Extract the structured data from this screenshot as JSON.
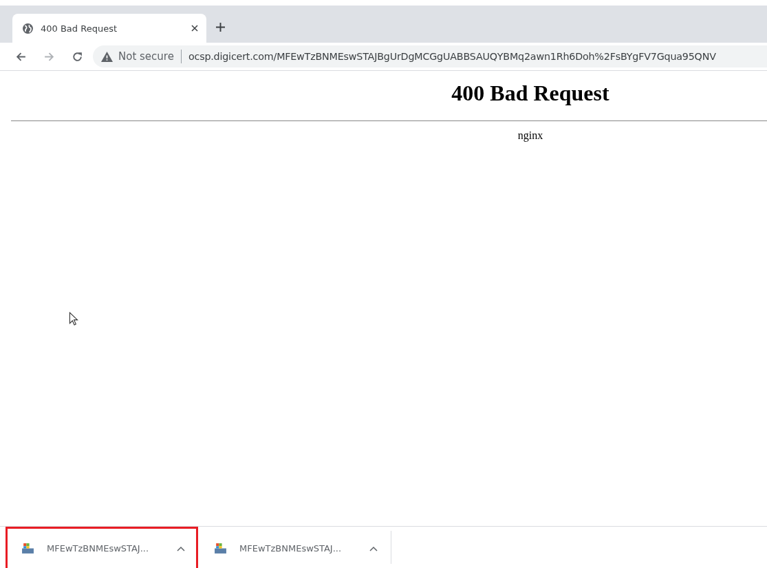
{
  "tabs": [
    {
      "title": "400 Bad Request",
      "selected": true
    }
  ],
  "address_bar": {
    "security": "Not secure",
    "url": "ocsp.digicert.com/MFEwTzBNMEswSTAJBgUrDgMCGgUABBSAUQYBMq2awn1Rh6Doh%2FsBYgFV7Gqua95QNV"
  },
  "page": {
    "heading": "400 Bad Request",
    "server": "nginx"
  },
  "downloads": [
    {
      "filename": "MFEwTzBNMEswSTAJ...",
      "highlighted": true
    },
    {
      "filename": "MFEwTzBNMEswSTAJ...",
      "highlighted": false
    }
  ]
}
